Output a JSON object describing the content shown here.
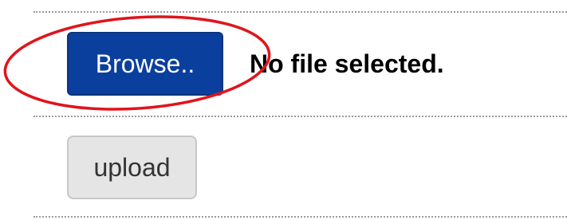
{
  "file_input": {
    "browse_label": "Browse..",
    "status_text": "No file selected."
  },
  "upload": {
    "label": "upload"
  },
  "colors": {
    "browse_button_bg": "#0b3f9e",
    "upload_button_bg": "#e5e5e5",
    "annotation_ellipse": "#e0141c"
  },
  "annotation": {
    "shape": "ellipse",
    "highlights": "browse-button"
  }
}
